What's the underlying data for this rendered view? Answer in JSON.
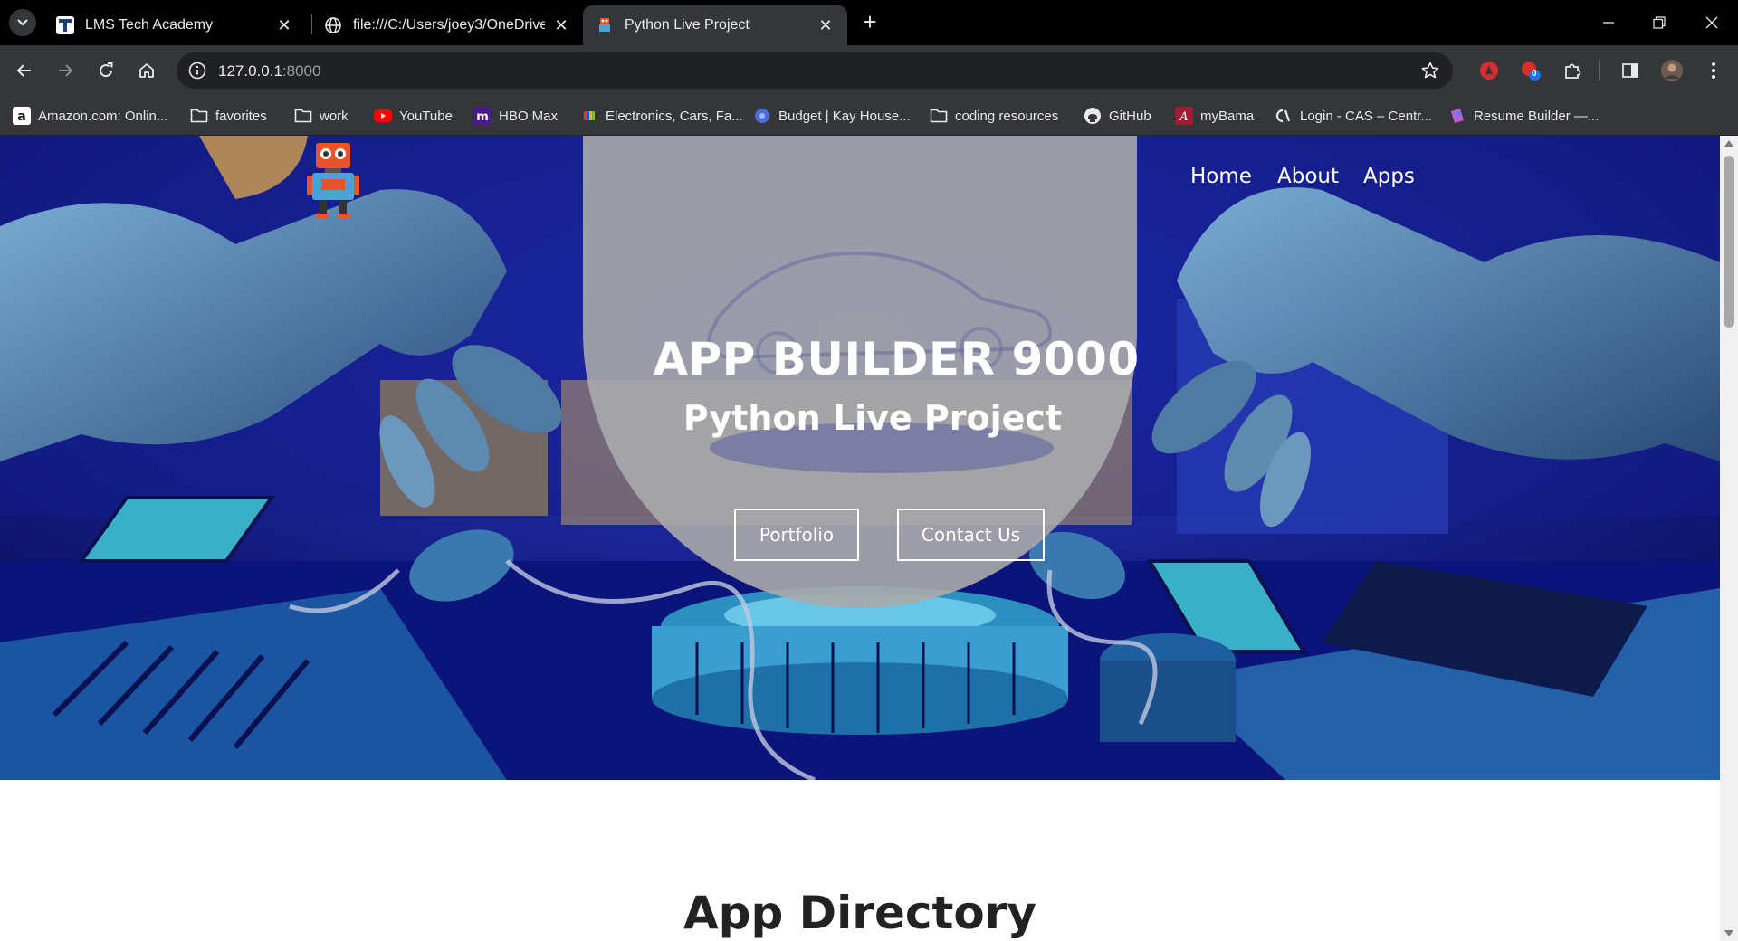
{
  "browser": {
    "tabs": [
      {
        "title": "LMS Tech Academy",
        "icon": "lms-favicon"
      },
      {
        "title": "file:///C:/Users/joey3/OneDrive/",
        "icon": "globe-icon"
      },
      {
        "title": "Python Live Project",
        "icon": "robot-favicon",
        "active": true
      }
    ],
    "address": {
      "host": "127.0.0.1",
      "port": ":8000"
    },
    "extension_badge": "0",
    "bookmarks": [
      {
        "label": "Amazon.com: Onlin...",
        "icon": "amazon-icon"
      },
      {
        "label": "favorites",
        "icon": "folder-icon"
      },
      {
        "label": "work",
        "icon": "folder-icon"
      },
      {
        "label": "YouTube",
        "icon": "youtube-icon"
      },
      {
        "label": "HBO Max",
        "icon": "hbo-max-icon"
      },
      {
        "label": "Electronics, Cars, Fa...",
        "icon": "ebay-icon"
      },
      {
        "label": "Budget | Kay House...",
        "icon": "budget-icon"
      },
      {
        "label": "coding resources",
        "icon": "folder-icon"
      },
      {
        "label": "GitHub",
        "icon": "github-icon"
      },
      {
        "label": "myBama",
        "icon": "mybama-icon"
      },
      {
        "label": "Login - CAS – Centr...",
        "icon": "cas-icon"
      },
      {
        "label": "Resume Builder —...",
        "icon": "resume-icon"
      }
    ]
  },
  "page": {
    "nav": {
      "home": "Home",
      "about": "About",
      "apps": "Apps"
    },
    "hero": {
      "title": "APP BUILDER 9000",
      "subtitle": "Python Live Project",
      "portfolio_button": "Portfolio",
      "contact_button": "Contact Us"
    },
    "section_title": "App Directory"
  },
  "colors": {
    "hero_background": "#0d1373",
    "hero_circle": "#9a9a9a",
    "robot_blue": "#3b5f86",
    "logo_orange": "#e8542a",
    "browser_dark": "#35363a"
  }
}
